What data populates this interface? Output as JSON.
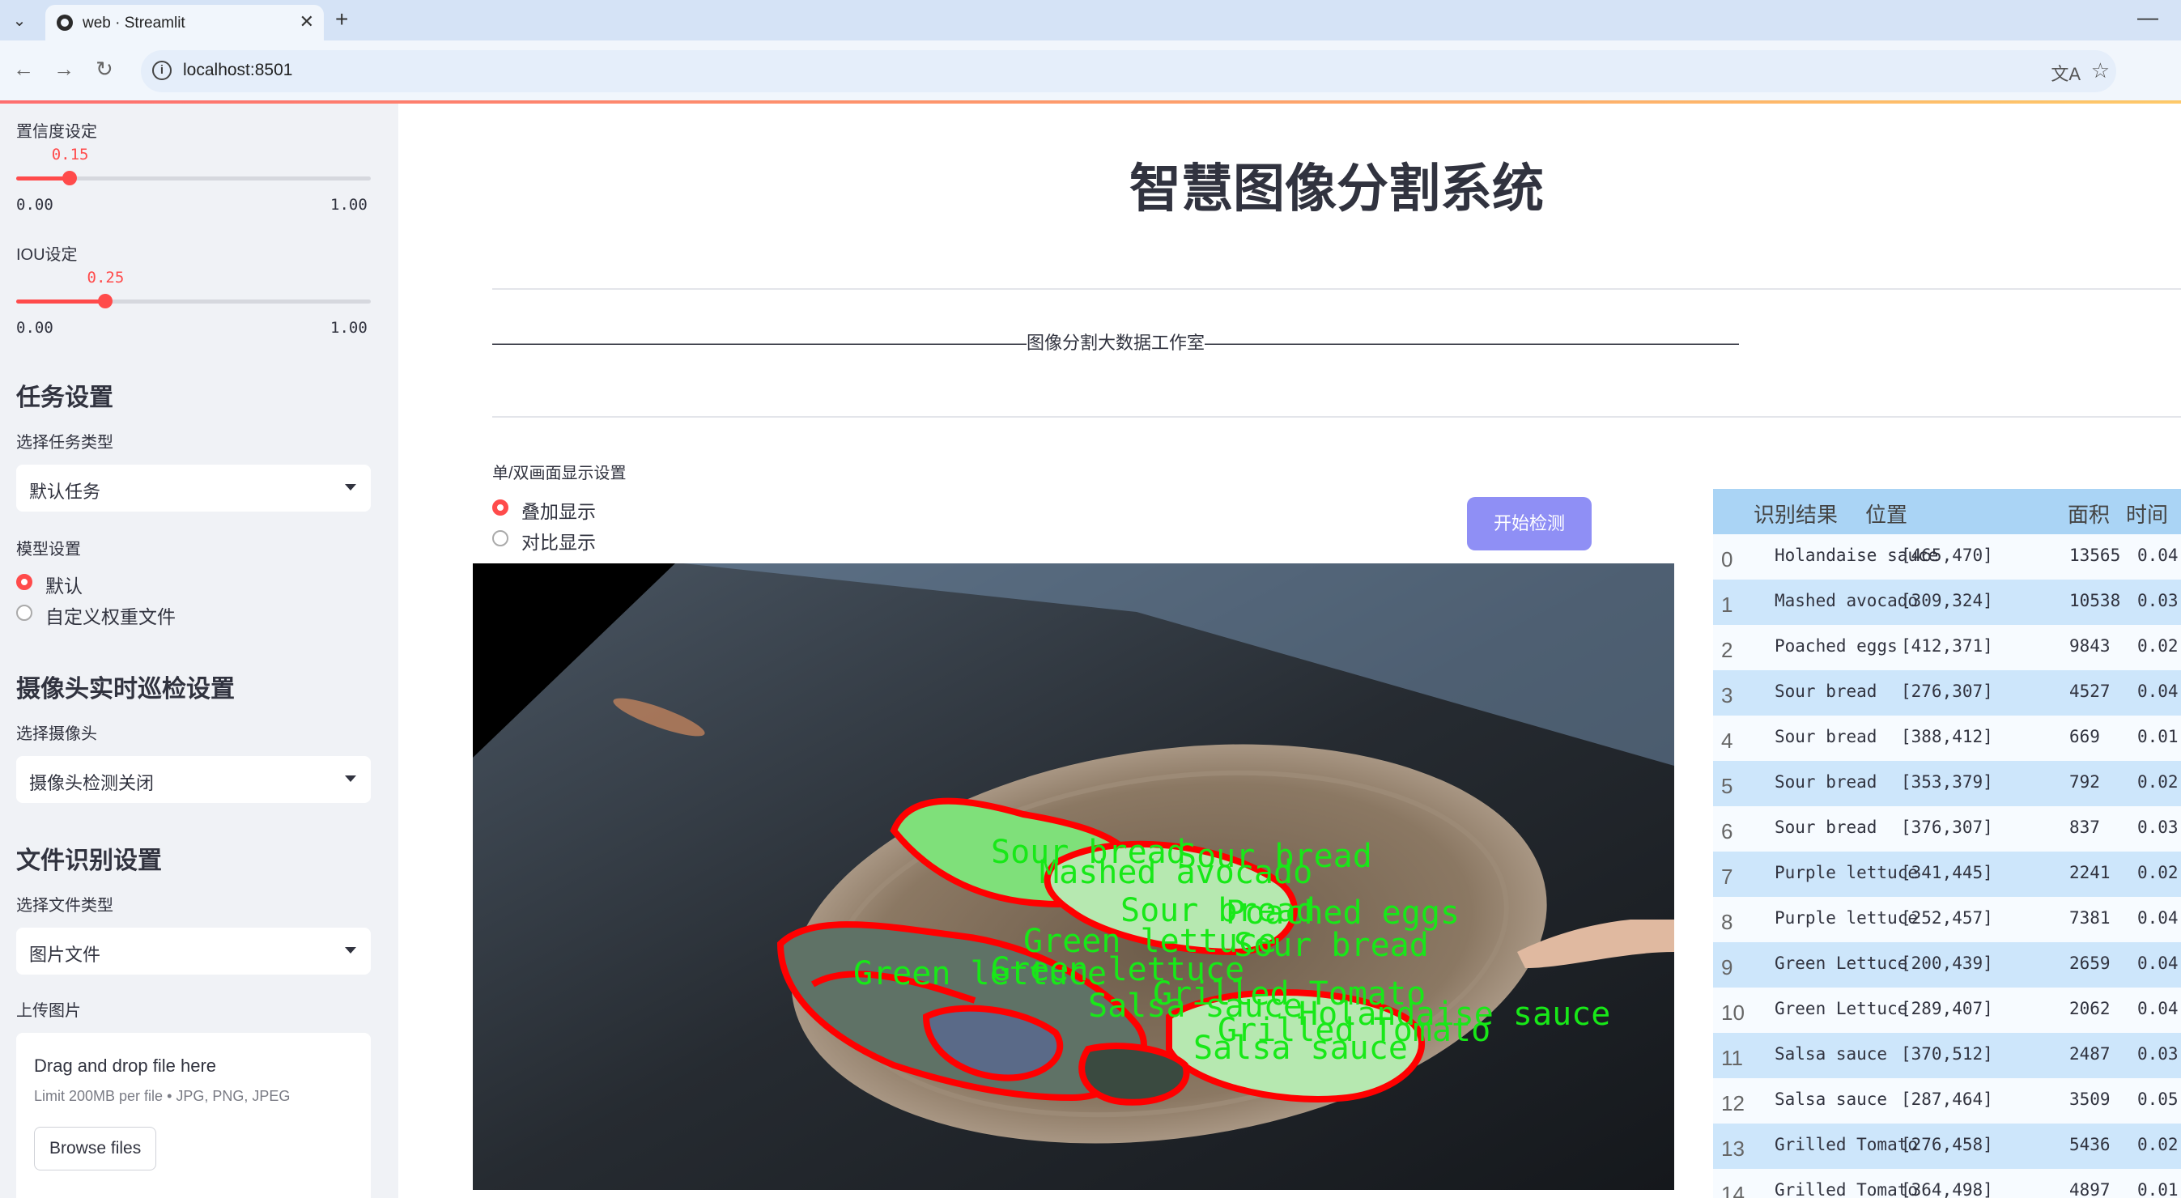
{
  "browser": {
    "tab_title": "web · Streamlit",
    "url": "localhost:8501"
  },
  "sidebar": {
    "confidence": {
      "label": "置信度设定",
      "value_text": "0.15",
      "value": 0.15,
      "min_text": "0.00",
      "max_text": "1.00"
    },
    "iou": {
      "label": "IOU设定",
      "value_text": "0.25",
      "value": 0.25,
      "min_text": "0.00",
      "max_text": "1.00"
    },
    "task_header": "任务设置",
    "task_type_label": "选择任务类型",
    "task_type_value": "默认任务",
    "model_label": "模型设置",
    "model_options": [
      "默认",
      "自定义权重文件"
    ],
    "model_selected": 0,
    "camera_header": "摄像头实时巡检设置",
    "camera_label": "选择摄像头",
    "camera_value": "摄像头检测关闭",
    "file_header": "文件识别设置",
    "file_type_label": "选择文件类型",
    "file_type_value": "图片文件",
    "upload_label": "上传图片",
    "upload_title": "Drag and drop file here",
    "upload_limit": "Limit 200MB per file • JPG, PNG, JPEG",
    "browse_label": "Browse files"
  },
  "main": {
    "title": "智慧图像分割系统",
    "divider_text": "——————————————————————————————图像分割大数据工作室——————————————————————————————",
    "display_label": "单/双画面显示设置",
    "display_options": [
      "叠加显示",
      "对比显示"
    ],
    "display_selected": 0,
    "start_button": "开始检测",
    "overlay_labels": [
      "Sour bread",
      "Sour bread",
      "Mashed avocado",
      "Poached eggs",
      "Sour bread",
      "Green lettuce",
      "Sour bread",
      "Green lettuce",
      "Green lettuce",
      "Grilled Tomato",
      "Salsa sauce",
      "Holandaise sauce",
      "Grilled Tomato",
      "Salsa sauce"
    ]
  },
  "table": {
    "headers": [
      "识别结果",
      "位置",
      "面积",
      "时间"
    ],
    "rows": [
      {
        "idx": "0",
        "name": "Holandaise sauce",
        "pos": "[465,470]",
        "area": "13565",
        "time": "0.04"
      },
      {
        "idx": "1",
        "name": "Mashed avocado",
        "pos": "[309,324]",
        "area": "10538",
        "time": "0.03"
      },
      {
        "idx": "2",
        "name": "Poached eggs",
        "pos": "[412,371]",
        "area": "9843",
        "time": "0.02"
      },
      {
        "idx": "3",
        "name": "Sour bread",
        "pos": "[276,307]",
        "area": "4527",
        "time": "0.04"
      },
      {
        "idx": "4",
        "name": "Sour bread",
        "pos": "[388,412]",
        "area": "669",
        "time": "0.01"
      },
      {
        "idx": "5",
        "name": "Sour bread",
        "pos": "[353,379]",
        "area": "792",
        "time": "0.02"
      },
      {
        "idx": "6",
        "name": "Sour bread",
        "pos": "[376,307]",
        "area": "837",
        "time": "0.03"
      },
      {
        "idx": "7",
        "name": "Purple lettuce",
        "pos": "[341,445]",
        "area": "2241",
        "time": "0.02"
      },
      {
        "idx": "8",
        "name": "Purple lettuce",
        "pos": "[252,457]",
        "area": "7381",
        "time": "0.04"
      },
      {
        "idx": "9",
        "name": "Green Lettuce",
        "pos": "[200,439]",
        "area": "2659",
        "time": "0.04"
      },
      {
        "idx": "10",
        "name": "Green Lettuce",
        "pos": "[289,407]",
        "area": "2062",
        "time": "0.04"
      },
      {
        "idx": "11",
        "name": "Salsa sauce",
        "pos": "[370,512]",
        "area": "2487",
        "time": "0.03"
      },
      {
        "idx": "12",
        "name": "Salsa sauce",
        "pos": "[287,464]",
        "area": "3509",
        "time": "0.05"
      },
      {
        "idx": "13",
        "name": "Grilled Tomato",
        "pos": "[276,458]",
        "area": "5436",
        "time": "0.02"
      },
      {
        "idx": "14",
        "name": "Grilled Tomato",
        "pos": "[364,498]",
        "area": "4897",
        "time": "0.01"
      }
    ]
  }
}
